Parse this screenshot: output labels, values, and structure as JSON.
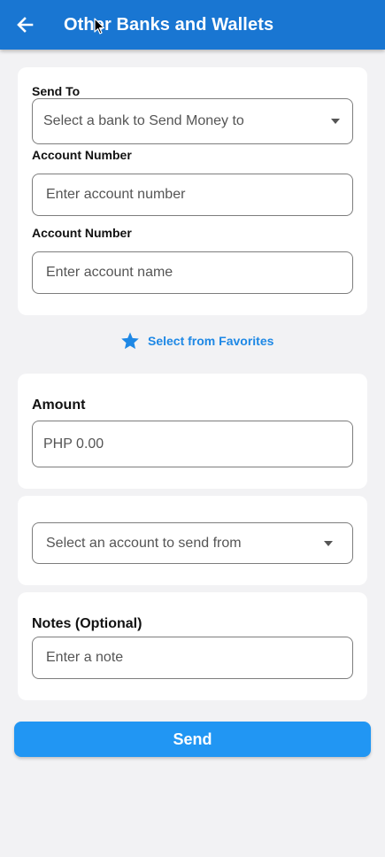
{
  "header": {
    "title": "Other Banks and Wallets",
    "back_icon": "arrow-left-icon",
    "background": "#1976d2"
  },
  "recipient": {
    "send_to_label": "Send To",
    "bank_select_placeholder": "Select a bank to Send Money to",
    "account_number_label": "Account Number",
    "account_number_placeholder": "Enter account number",
    "account_name_label": "Account Number",
    "account_name_placeholder": "Enter account name"
  },
  "favorites": {
    "label": "Select from Favorites",
    "icon": "star-icon",
    "color": "#1e88e5"
  },
  "amount": {
    "label": "Amount",
    "placeholder": "PHP 0.00"
  },
  "source": {
    "select_placeholder": "Select an account to send from"
  },
  "notes": {
    "label": "Notes (Optional)",
    "placeholder": "Enter a note"
  },
  "actions": {
    "send_label": "Send",
    "send_color": "#2196f3"
  }
}
